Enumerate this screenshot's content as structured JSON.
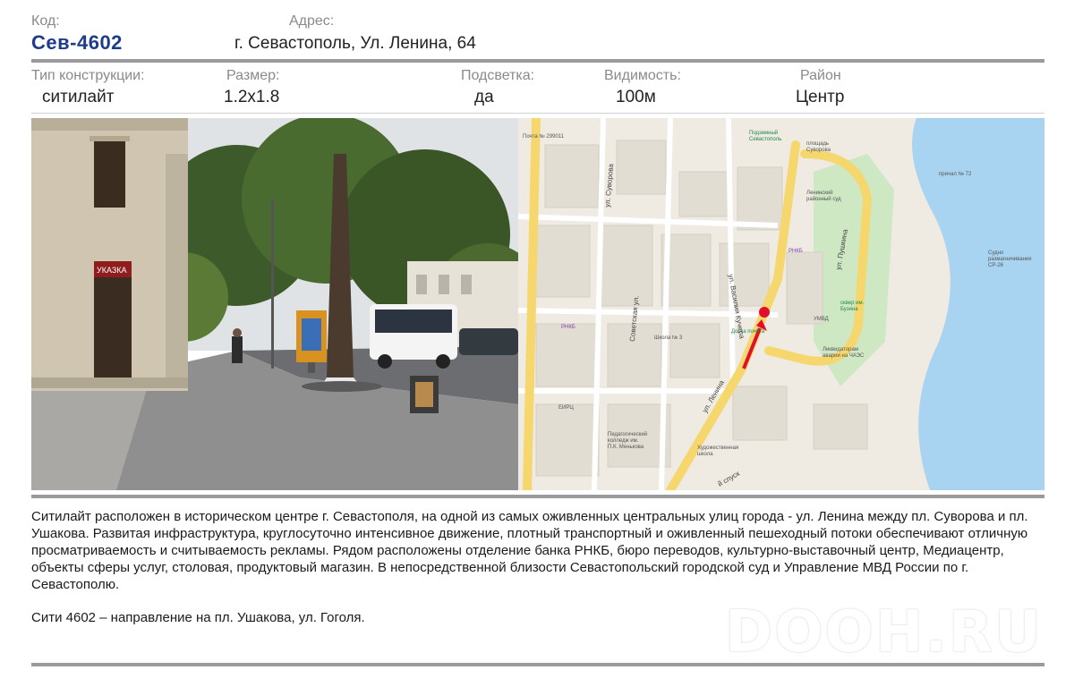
{
  "header": {
    "code_label": "Код:",
    "code_value": "Сев-4602",
    "address_label": "Адрес:",
    "address_value": "г. Севастополь, Ул. Ленина, 64"
  },
  "specs": [
    {
      "label": "Тип конструкции:",
      "value": "ситилайт"
    },
    {
      "label": "Размер:",
      "value": "1.2x1.8"
    },
    {
      "label": "Подсветка:",
      "value": "да"
    },
    {
      "label": "Видимость:",
      "value": "100м"
    },
    {
      "label": "Район",
      "value": "Центр"
    }
  ],
  "photo": {
    "sign": "УКАЗКА"
  },
  "map": {
    "labels": {
      "pochta": "Почта № 299011",
      "underground": "Подземный\nСевастополь",
      "square": "площадь\nСуворова",
      "pier": "причал № 72",
      "court": "Ленинский\nрайонный суд",
      "rnkb1": "РНКБ",
      "rnkb2": "РНКБ",
      "umvd": "УМВД",
      "park": "сквер им.\nБузина",
      "liquidators": "Ликвидаторам\nаварии на ЧАЭС",
      "ship": "Судно\nразмагничивания\nСР-26",
      "doska": "Доска почёта",
      "school": "Школа № 3",
      "college": "Педагогический\nколледж им.\nП.К. Менькова",
      "art_school": "Художественная\nшкола",
      "eirc": "ЕИРЦ",
      "street_lenina": "ул. Ленина",
      "street_pushkina": "ул. Пушкина",
      "street_suvorova": "ул. Суворова",
      "street_sovetskaya": "Советская ул.",
      "street_kuchera": "ул. Василия Кучера",
      "street_spusk": "й спуск",
      "numbers": [
        "13",
        "25",
        "31",
        "36",
        "42",
        "54",
        "56",
        "62",
        "38",
        "40",
        "33",
        "64",
        "37",
        "12",
        "28",
        "29",
        "30",
        "48",
        "50",
        "54",
        "70",
        "41",
        "45А",
        "45",
        "13",
        "594",
        "74Б",
        "39А",
        "10",
        "17",
        "22",
        "4",
        "5",
        "5А"
      ]
    }
  },
  "description": "Ситилайт  расположен в историческом центре г. Севастополя, на одной из самых оживленных центральных улиц  города - ул. Ленина между пл. Суворова и пл. Ушакова. Развитая инфраструктура, круглосуточно интенсивное движение, плотный транспортный и оживленный пешеходный потоки обеспечивают отличную просматриваемость и считываемость рекламы. Рядом расположены отделение банка РНКБ, бюро переводов,  культурно-выставочный центр, Медиацентр, объекты сферы услуг, столовая, продуктовый магазин. В непосредственной близости Севастопольский городской суд и Управление МВД России по г. Севастополю.",
  "direction": "Сити 4602 – направление на пл. Ушакова, ул. Гоголя.",
  "watermark": "DOOH.RU",
  "colors": {
    "code": "#1f3c8c",
    "rule": "#9a9a9a",
    "marker": "#e0102a",
    "road": "#f5d76e",
    "water": "#a8d4f2"
  }
}
